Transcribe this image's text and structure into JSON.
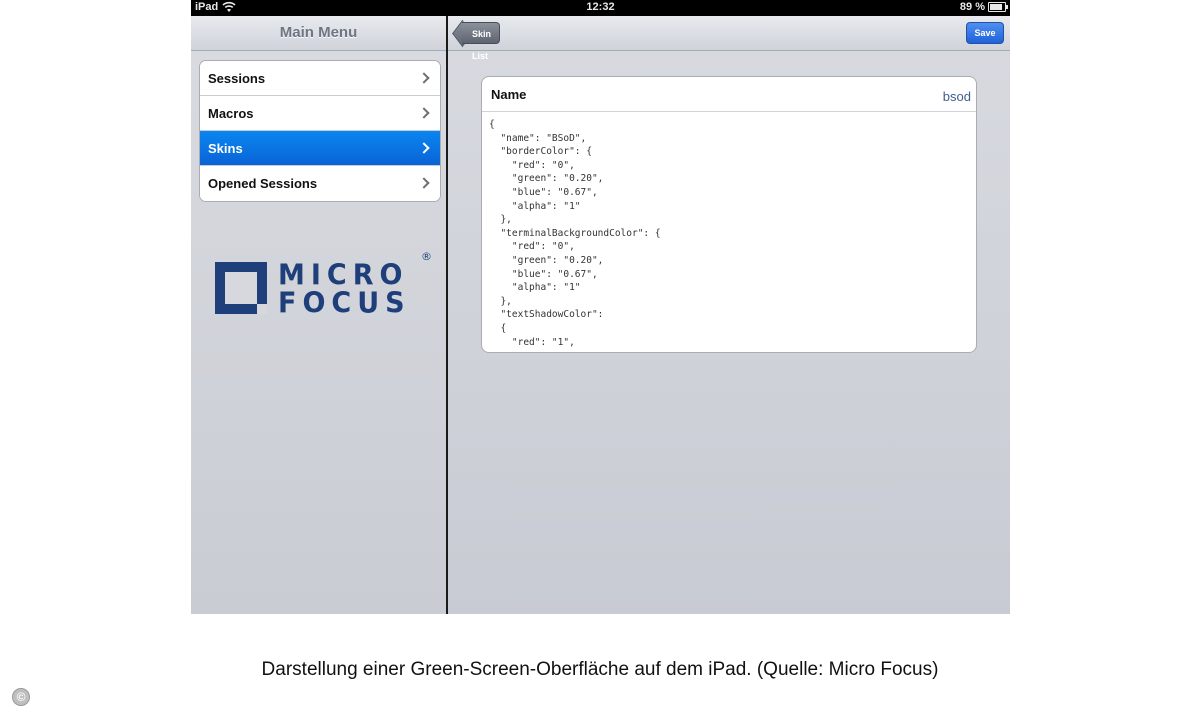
{
  "status_bar": {
    "device": "iPad",
    "time": "12:32",
    "battery": "89 %"
  },
  "left_pane": {
    "title": "Main Menu",
    "items": [
      {
        "label": "Sessions",
        "selected": false
      },
      {
        "label": "Macros",
        "selected": false
      },
      {
        "label": "Skins",
        "selected": true
      },
      {
        "label": "Opened Sessions",
        "selected": false
      }
    ],
    "logo": {
      "line1": "MICRO",
      "line2": "FOCUS",
      "registered": "®",
      "color": "#1e3f7a"
    }
  },
  "right_pane": {
    "back_label": "Skin List",
    "save_label": "Save",
    "card": {
      "name_label": "Name",
      "name_value": "bsod",
      "json": "{\n  \"name\": \"BSoD\",\n  \"borderColor\": {\n    \"red\": \"0\",\n    \"green\": \"0.20\",\n    \"blue\": \"0.67\",\n    \"alpha\": \"1\"\n  },\n  \"terminalBackgroundColor\": {\n    \"red\": \"0\",\n    \"green\": \"0.20\",\n    \"blue\": \"0.67\",\n    \"alpha\": \"1\"\n  },\n  \"textShadowColor\":\n  {\n    \"red\": \"1\","
    }
  },
  "caption": "Darstellung einer Green-Screen-Oberfläche auf dem iPad. (Quelle: Micro Focus)",
  "copyright_symbol": "©",
  "colors": {
    "selected_row": "#0a6fe3",
    "save_button": "#2f72e4",
    "name_value": "#3f5f8f"
  }
}
